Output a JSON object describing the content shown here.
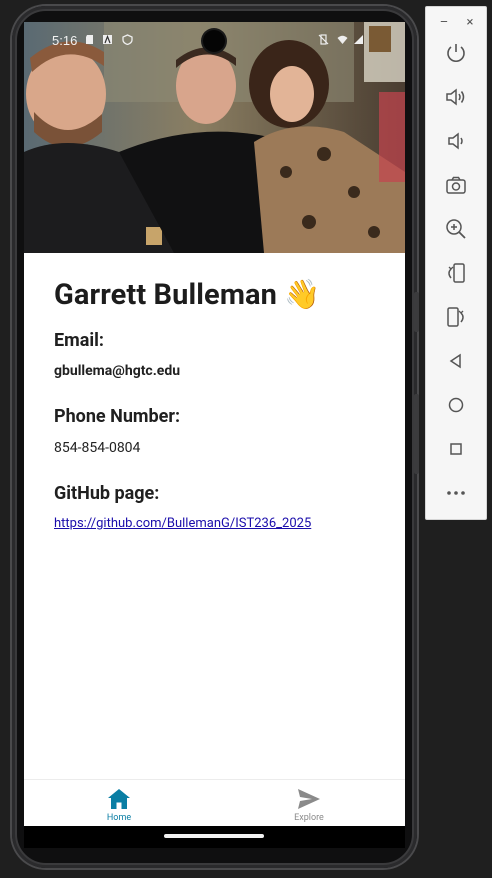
{
  "status_bar": {
    "time": "5:16"
  },
  "profile": {
    "name": "Garrett Bulleman",
    "wave_emoji": "👋",
    "email_label": "Email:",
    "email": "gbullema@hgtc.edu",
    "phone_label": "Phone Number:",
    "phone": "854-854-0804",
    "github_label": "GitHub page:",
    "github_url": "https://github.com/BullemanG/IST236_2025"
  },
  "tabs": [
    {
      "label": "Home",
      "icon": "home-icon",
      "active": true
    },
    {
      "label": "Explore",
      "icon": "send-icon",
      "active": false
    }
  ],
  "colors": {
    "accent": "#0a7ea4",
    "inactive": "#8a8a8a",
    "link": "#1a0dab"
  },
  "emulator_toolbar": {
    "window_controls": [
      "minimize-icon",
      "close-icon"
    ],
    "buttons": [
      "power-icon",
      "volume-up-icon",
      "volume-down-icon",
      "camera-icon",
      "zoom-icon",
      "rotate-left-icon",
      "rotate-right-icon",
      "back-icon",
      "home-circle-icon",
      "overview-icon",
      "more-icon"
    ],
    "minimize_glyph": "–",
    "close_glyph": "×"
  }
}
